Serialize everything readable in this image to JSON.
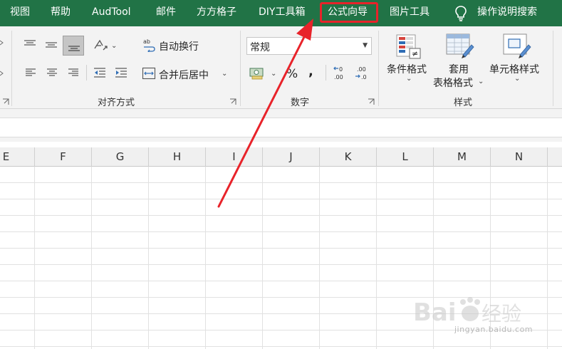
{
  "ribbon_tabs": [
    "视图",
    "帮助",
    "AudTool",
    "邮件",
    "方方格子",
    "DIY工具箱",
    "公式向导",
    "图片工具"
  ],
  "search_label": "操作说明搜索",
  "alignment": {
    "wrap_text": "自动换行",
    "merge_center": "合并后居中",
    "group_label": "对齐方式"
  },
  "number": {
    "format_value": "常规",
    "group_label": "数字",
    "percent_symbol": "%",
    "comma_symbol": ","
  },
  "styles": {
    "conditional_format": "条件格式",
    "table_format_line1": "套用",
    "table_format_line2": "表格格式",
    "cell_styles": "单元格样式",
    "group_label": "样式"
  },
  "columns": [
    "E",
    "F",
    "G",
    "H",
    "I",
    "J",
    "K",
    "L",
    "M",
    "N"
  ],
  "watermark": {
    "brand": "Bai",
    "brand_suffix": "经验",
    "url": "jingyan.baidu.com"
  },
  "colors": {
    "ribbon_tab_bg": "#217346",
    "highlight_box": "#e8232a",
    "annotation_arrow": "#e8232a"
  },
  "icons": [
    "lightbulb-icon",
    "orientation-icon",
    "wrap-text-icon",
    "merge-center-icon",
    "currency-icon",
    "increase-decimal-icon",
    "decrease-decimal-icon",
    "conditional-format-icon",
    "table-format-icon",
    "cell-styles-icon",
    "dialog-launcher-icon"
  ]
}
